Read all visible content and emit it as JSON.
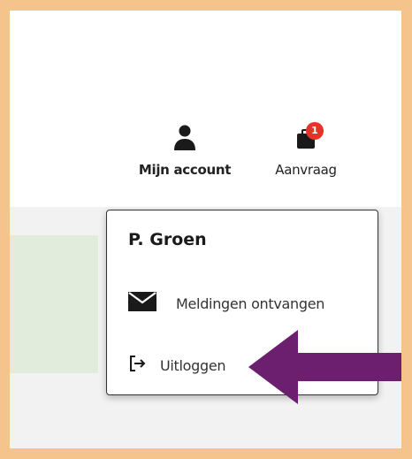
{
  "header": {
    "account_label": "Mijn account",
    "aanvraag_label": "Aanvraag",
    "aanvraag_badge": "1"
  },
  "dropdown": {
    "user_name": "P. Groen",
    "items": [
      {
        "label": "Meldingen ontvangen",
        "icon": "mail-icon"
      },
      {
        "label": "Uitloggen",
        "icon": "logout-icon"
      }
    ]
  },
  "colors": {
    "frame_border": "#f5c48d",
    "badge": "#e3342a",
    "arrow": "#6b1f6e",
    "green_panel": "#e2ecdd"
  }
}
